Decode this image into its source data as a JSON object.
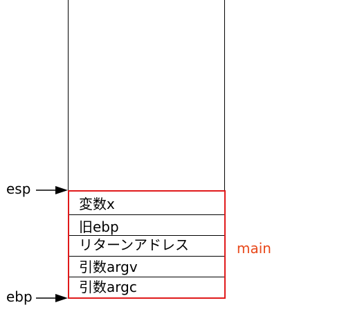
{
  "registers": {
    "esp": "esp",
    "ebp": "ebp"
  },
  "stack": {
    "cells": [
      {
        "label": "変数x"
      },
      {
        "label": "旧ebp"
      },
      {
        "label": "リターンアドレス"
      },
      {
        "label": "引数argv"
      },
      {
        "label": "引数argc"
      }
    ]
  },
  "frame": {
    "label": "main",
    "color": "#e0191a",
    "label_color": "#e8481a"
  }
}
